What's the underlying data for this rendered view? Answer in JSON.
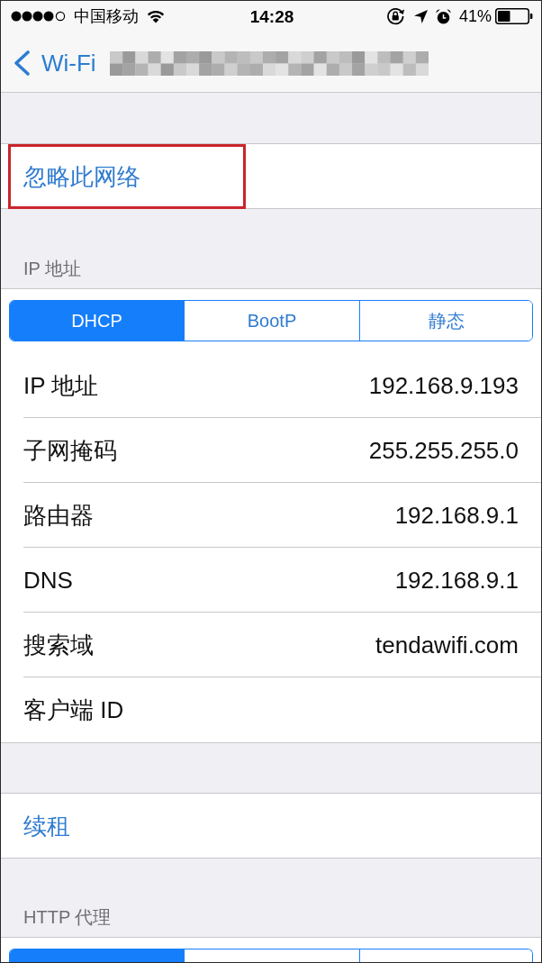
{
  "status_bar": {
    "carrier": "中国移动",
    "time": "14:28",
    "battery": "41%"
  },
  "nav_bar": {
    "back_label": "Wi-Fi"
  },
  "forget_network": {
    "label": "忽略此网络",
    "highlighted": true
  },
  "ip_section": {
    "header": "IP 地址",
    "modes": [
      {
        "label": "DHCP",
        "selected": true
      },
      {
        "label": "BootP",
        "selected": false
      },
      {
        "label": "静态",
        "selected": false
      }
    ],
    "rows": [
      {
        "label": "IP 地址",
        "value": "192.168.9.193"
      },
      {
        "label": "子网掩码",
        "value": "255.255.255.0"
      },
      {
        "label": "路由器",
        "value": "192.168.9.1"
      },
      {
        "label": "DNS",
        "value": "192.168.9.1"
      },
      {
        "label": "搜索域",
        "value": "tendawifi.com"
      },
      {
        "label": "客户端 ID"
      }
    ]
  },
  "renew_lease": {
    "label": "续租"
  },
  "http_proxy": {
    "header": "HTTP 代理",
    "modes": [
      {
        "selected": true
      },
      {
        "selected": false
      },
      {
        "selected": false
      }
    ]
  }
}
